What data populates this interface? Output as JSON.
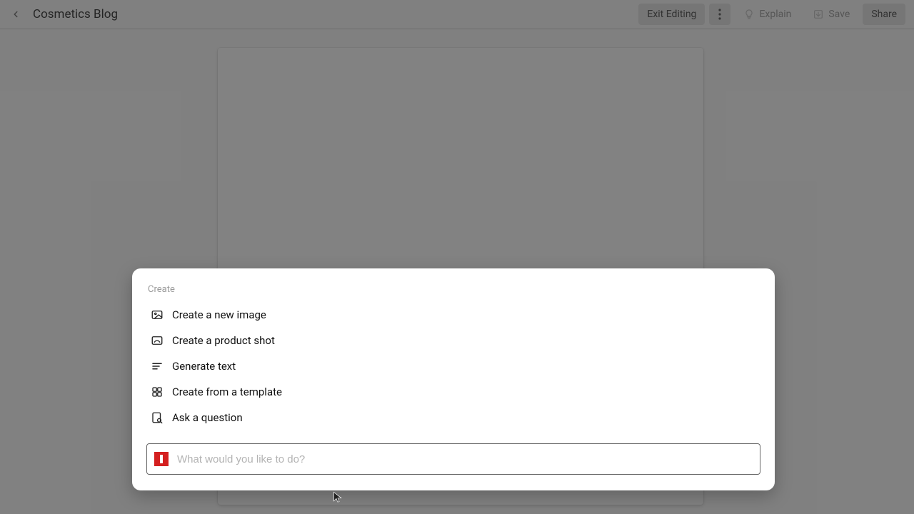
{
  "topbar": {
    "title": "Cosmetics Blog",
    "exit_label": "Exit Editing",
    "explain_label": "Explain",
    "save_label": "Save",
    "share_label": "Share"
  },
  "panel": {
    "section": "Create",
    "items": [
      {
        "label": "Create a new image"
      },
      {
        "label": "Create a product shot"
      },
      {
        "label": "Generate text"
      },
      {
        "label": "Create from a template"
      },
      {
        "label": "Ask a question"
      }
    ],
    "placeholder": "What would you like to do?"
  }
}
